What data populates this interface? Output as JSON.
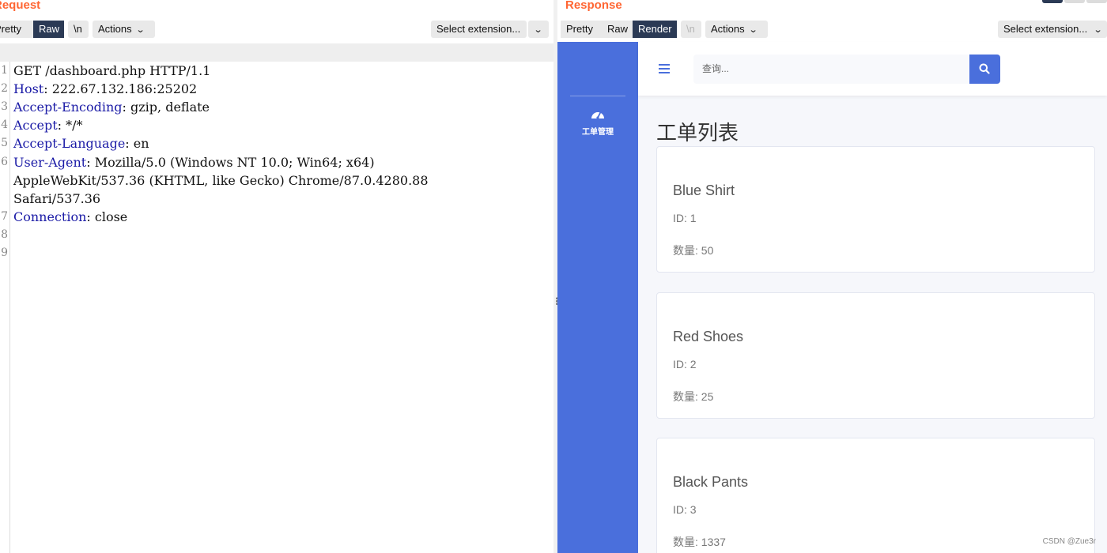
{
  "request": {
    "title": "Request",
    "tabs": {
      "pretty": "Pretty",
      "raw": "Raw",
      "newline": "\\n"
    },
    "actions_label": "Actions",
    "select_extension_label": "Select extension...",
    "lines": [
      {
        "num": "1",
        "name": "",
        "sep": "",
        "value": "GET /dashboard.php HTTP/1.1"
      },
      {
        "num": "2",
        "name": "Host",
        "sep": ":",
        "value": " 222.67.132.186:25202"
      },
      {
        "num": "3",
        "name": "Accept-Encoding",
        "sep": ":",
        "value": " gzip, deflate"
      },
      {
        "num": "4",
        "name": "Accept",
        "sep": ":",
        "value": " */*"
      },
      {
        "num": "5",
        "name": "Accept-Language",
        "sep": ":",
        "value": " en"
      },
      {
        "num": "6",
        "name": "User-Agent",
        "sep": ":",
        "value": " Mozilla/5.0 (Windows NT 10.0; Win64; x64)"
      },
      {
        "num": "",
        "name": "",
        "sep": "",
        "value": "AppleWebKit/537.36 (KHTML, like Gecko) Chrome/87.0.4280.88"
      },
      {
        "num": "",
        "name": "",
        "sep": "",
        "value": "Safari/537.36"
      },
      {
        "num": "7",
        "name": "Connection",
        "sep": ":",
        "value": " close"
      },
      {
        "num": "8",
        "name": "",
        "sep": "",
        "value": ""
      },
      {
        "num": "9",
        "name": "",
        "sep": "",
        "value": ""
      }
    ]
  },
  "response": {
    "title": "Response",
    "tabs": {
      "pretty": "Pretty",
      "raw": "Raw",
      "render": "Render",
      "newline": "\\n"
    },
    "actions_label": "Actions",
    "select_extension_label": "Select extension...",
    "render": {
      "sidebar": {
        "nav_label": "工单管理",
        "nav_icon": "dashboard-icon"
      },
      "search": {
        "placeholder": "查询..."
      },
      "heading": "工单列表",
      "items": [
        {
          "name": "Blue Shirt",
          "id_text": "ID: 1",
          "qty_text": "数量: 50"
        },
        {
          "name": "Red Shoes",
          "id_text": "ID: 2",
          "qty_text": "数量: 25"
        },
        {
          "name": "Black Pants",
          "id_text": "ID: 3",
          "qty_text": "数量: 1337"
        }
      ]
    }
  },
  "watermark": "CSDN @Zue3r",
  "colors": {
    "title_orange": "#ff6633",
    "active_tab": "#2b3a55",
    "header_name": "#1a1aa6",
    "sidebar_blue": "#4a6fdc"
  }
}
